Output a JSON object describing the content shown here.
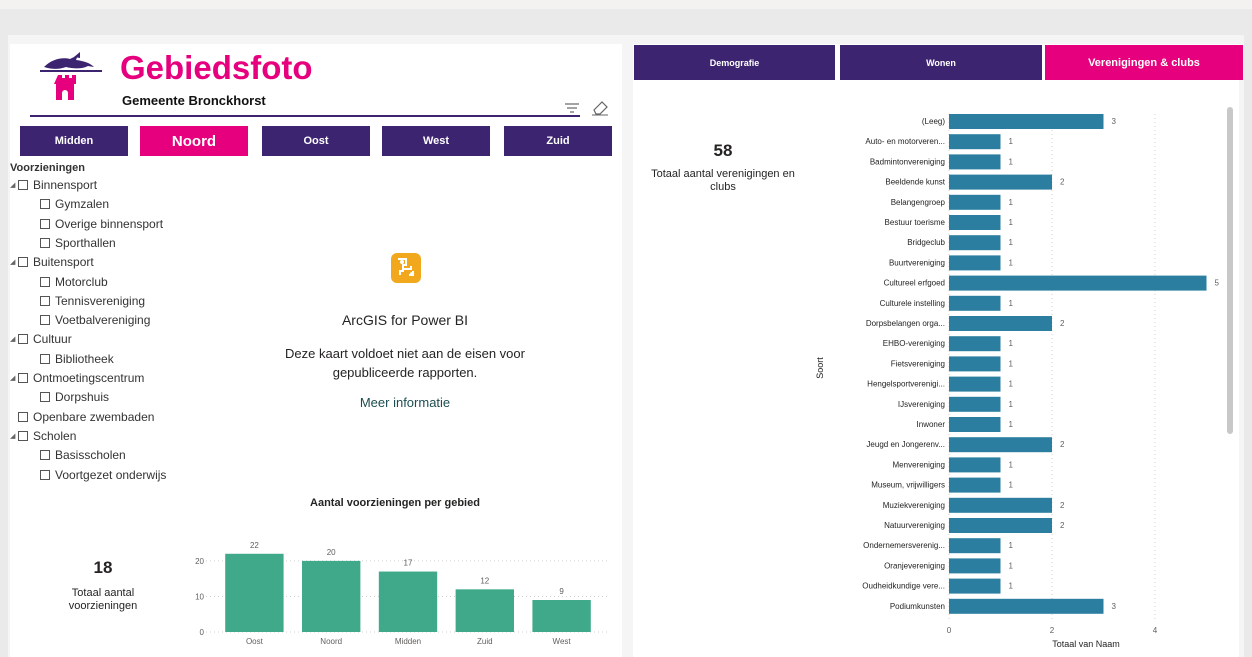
{
  "header": {
    "title": "Gebiedsfoto",
    "subtitle": "Gemeente Bronckhorst"
  },
  "colors": {
    "brand_purple": "#3c2470",
    "brand_pink": "#e6007e",
    "bar_green": "#3fa98a",
    "bar_blue": "#2b7ea0",
    "arcgis_orange": "#f2a81d"
  },
  "area_buttons": [
    {
      "label": "Midden",
      "active": false
    },
    {
      "label": "Noord",
      "active": true
    },
    {
      "label": "Oost",
      "active": false
    },
    {
      "label": "West",
      "active": false
    },
    {
      "label": "Zuid",
      "active": false
    }
  ],
  "slicer": {
    "title": "Voorzieningen",
    "items": [
      {
        "label": "Binnensport",
        "level": 0,
        "expandable": true
      },
      {
        "label": "Gymzalen",
        "level": 1,
        "expandable": false
      },
      {
        "label": "Overige binnensport",
        "level": 1,
        "expandable": false
      },
      {
        "label": "Sporthallen",
        "level": 1,
        "expandable": false
      },
      {
        "label": "Buitensport",
        "level": 0,
        "expandable": true
      },
      {
        "label": "Motorclub",
        "level": 1,
        "expandable": false
      },
      {
        "label": "Tennisvereniging",
        "level": 1,
        "expandable": false
      },
      {
        "label": "Voetbalvereniging",
        "level": 1,
        "expandable": false
      },
      {
        "label": "Cultuur",
        "level": 0,
        "expandable": true
      },
      {
        "label": "Bibliotheek",
        "level": 1,
        "expandable": false
      },
      {
        "label": "Ontmoetingscentrum",
        "level": 0,
        "expandable": true
      },
      {
        "label": "Dorpshuis",
        "level": 1,
        "expandable": false
      },
      {
        "label": "Openbare zwembaden",
        "level": 0,
        "expandable": false
      },
      {
        "label": "Scholen",
        "level": 0,
        "expandable": true
      },
      {
        "label": "Basisscholen",
        "level": 1,
        "expandable": false
      },
      {
        "label": "Voortgezet onderwijs",
        "level": 1,
        "expandable": false
      }
    ]
  },
  "arcgis": {
    "title": "ArcGIS for Power BI",
    "message": "Deze kaart voldoet niet aan de eisen voor gepubliceerde rapporten.",
    "link": "Meer informatie",
    "icon": "arcgis-map-icon"
  },
  "card_left": {
    "value": "18",
    "label": "Totaal aantal voorzieningen"
  },
  "card_right": {
    "value": "58",
    "label": "Totaal aantal verenigingen en clubs"
  },
  "tabs": [
    {
      "label": "Demografie",
      "active": false
    },
    {
      "label": "Wonen",
      "active": false
    },
    {
      "label": "Verenigingen & clubs",
      "active": true
    }
  ],
  "chart_data": [
    {
      "type": "bar",
      "title": "Aantal voorzieningen per gebied",
      "categories": [
        "Oost",
        "Noord",
        "Midden",
        "Zuid",
        "West"
      ],
      "values": [
        22,
        20,
        17,
        12,
        9
      ],
      "yticks": [
        0,
        10,
        20
      ],
      "ylim": [
        0,
        25
      ],
      "grid": true,
      "data_labels": true
    },
    {
      "type": "bar",
      "orientation": "horizontal",
      "title": "",
      "xlabel": "Totaal van Naam",
      "ylabel": "Soort",
      "categories": [
        "(Leeg)",
        "Auto- en motorveren...",
        "Badmintonvereniging",
        "Beeldende kunst",
        "Belangengroep",
        "Bestuur toerisme",
        "Bridgeclub",
        "Buurtvereniging",
        "Cultureel erfgoed",
        "Culturele instelling",
        "Dorpsbelangen orga...",
        "EHBO-vereniging",
        "Fietsvereniging",
        "Hengelsportverenigi...",
        "IJsvereniging",
        "Inwoner",
        "Jeugd en Jongerenv...",
        "Menvereniging",
        "Museum, vrijwilligers",
        "Muziekvereniging",
        "Natuurvereniging",
        "Ondernemersverenig...",
        "Oranjevereniging",
        "Oudheidkundige vere...",
        "Podiumkunsten"
      ],
      "values": [
        3,
        1,
        1,
        2,
        1,
        1,
        1,
        1,
        5,
        1,
        2,
        1,
        1,
        1,
        1,
        1,
        2,
        1,
        1,
        2,
        2,
        1,
        1,
        1,
        3
      ],
      "xticks": [
        0,
        2,
        4
      ],
      "xlim": [
        0,
        5
      ],
      "grid": true,
      "data_labels": true
    }
  ]
}
